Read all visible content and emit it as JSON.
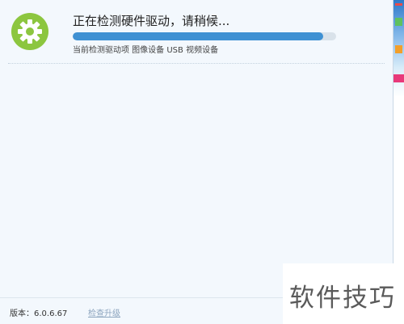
{
  "status": {
    "title": "正在检测硬件驱动，请稍候...",
    "detail": "当前检测驱动项 图像设备 USB 视频设备",
    "progress": 0.95
  },
  "icons": {
    "status_icon": "gear-icon"
  },
  "colors": {
    "icon_bg": "#8cc63f",
    "progress_fill": "#3f91d3",
    "progress_track": "#d9e2ea",
    "panel_bg": "#f3f8fd"
  },
  "footer": {
    "version": "版本：6.0.6.67",
    "update_link": "检查升级"
  },
  "watermark": {
    "text": "软件技巧"
  }
}
